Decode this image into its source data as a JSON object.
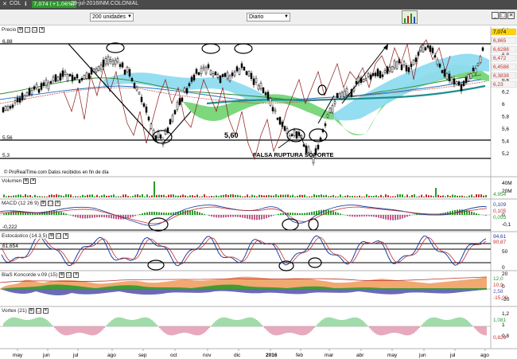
{
  "window": {
    "title": "COL",
    "price": "7,074 (+1,06%)",
    "date": "29-jul-2016",
    "company": "INM.COLONIAL"
  },
  "toolbar": {
    "units": "200 unidades",
    "period": "Diario"
  },
  "panels": {
    "precio": "Precio",
    "volumen": "Volumen",
    "macd": "MACD (12 26 9)",
    "estocastico": "Estocástico (14 3 5)",
    "bias": "BiaS Koncorde v.09 (15)",
    "vortex": "Vortex (21)"
  },
  "source_note": "© ProRealTime.com  Datos recibidos en fin de día",
  "annotations": {
    "support": "5,60",
    "false_break": "FALSA RUPTURA SOPORTE",
    "level_688": "6,88",
    "level_556": "5,56",
    "level_53": "5,3",
    "macd_level": "-0,222",
    "stoch_level": "61,654"
  },
  "right_axis": {
    "price_ticks": [
      "7,2",
      "7",
      "6,8",
      "6,6",
      "6,4",
      "6,2",
      "6",
      "5,8",
      "5,6",
      "5,4",
      "5,2"
    ],
    "price_badges": [
      "7,074",
      "6,865",
      "6,6288",
      "6,472",
      "6,4588",
      "6,3838",
      "6,23"
    ],
    "volumen_ticks": [
      "40M",
      "20M"
    ],
    "volumen_badge": "4,954",
    "macd_ticks": [
      "0",
      "-0,1"
    ],
    "macd_badges": [
      "0,109",
      "0,105",
      "0,053"
    ],
    "stoch_ticks": [
      "50",
      "0"
    ],
    "stoch_badges": [
      "94,61",
      "90,87"
    ],
    "bias_ticks": [
      "20",
      "0",
      "-20"
    ],
    "bias_badges": [
      "12,0",
      "10,9",
      "2,58",
      "-15,00"
    ],
    "vortex_ticks": [
      "1,2",
      "1",
      "0,8"
    ],
    "vortex_badges": [
      "1,081",
      "0,829"
    ]
  },
  "x_axis": {
    "labels": [
      "may",
      "jun",
      "jul",
      "ago",
      "sep",
      "oct",
      "nov",
      "dic",
      "2016",
      "feb",
      "mar",
      "abr",
      "may",
      "jun",
      "jul",
      "ago"
    ]
  },
  "colors": {
    "title_bg": "#4a4a4a",
    "price_up": "#2c9a2c",
    "kumo_green": "#6fd36f",
    "kumo_blue": "#8fdcf0",
    "teal_ma": "#1f8f8f",
    "candle": "#000000",
    "red_line": "#8b1a1a"
  }
}
